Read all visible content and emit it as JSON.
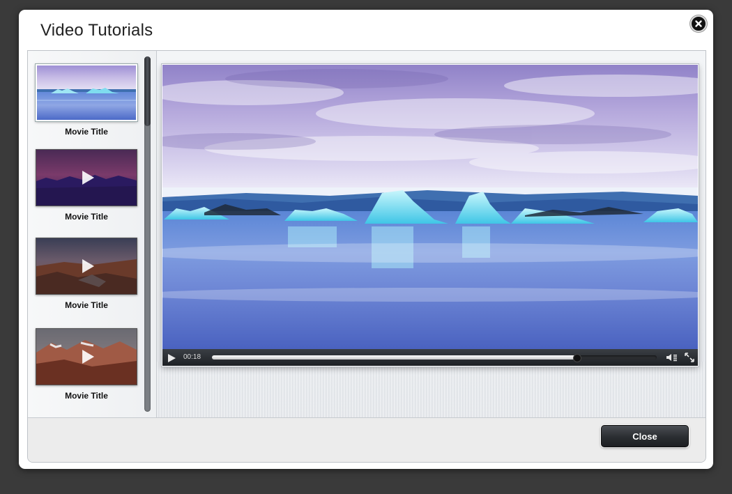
{
  "dialog": {
    "title": "Video Tutorials",
    "close_icon": "close-icon"
  },
  "playlist": {
    "items": [
      {
        "label": "Movie Title",
        "active": true,
        "scene": "iceberg-lagoon"
      },
      {
        "label": "Movie Title",
        "active": false,
        "scene": "purple-forest-dusk"
      },
      {
        "label": "Movie Title",
        "active": false,
        "scene": "rocky-coast-sunset"
      },
      {
        "label": "Movie Title",
        "active": false,
        "scene": "red-mountains"
      }
    ]
  },
  "player": {
    "current_time": "00:18",
    "progress_fraction": 0.82,
    "play_icon": "play-icon",
    "volume_icon": "volume-icon",
    "fullscreen_icon": "fullscreen-icon"
  },
  "footer": {
    "close_label": "Close"
  }
}
